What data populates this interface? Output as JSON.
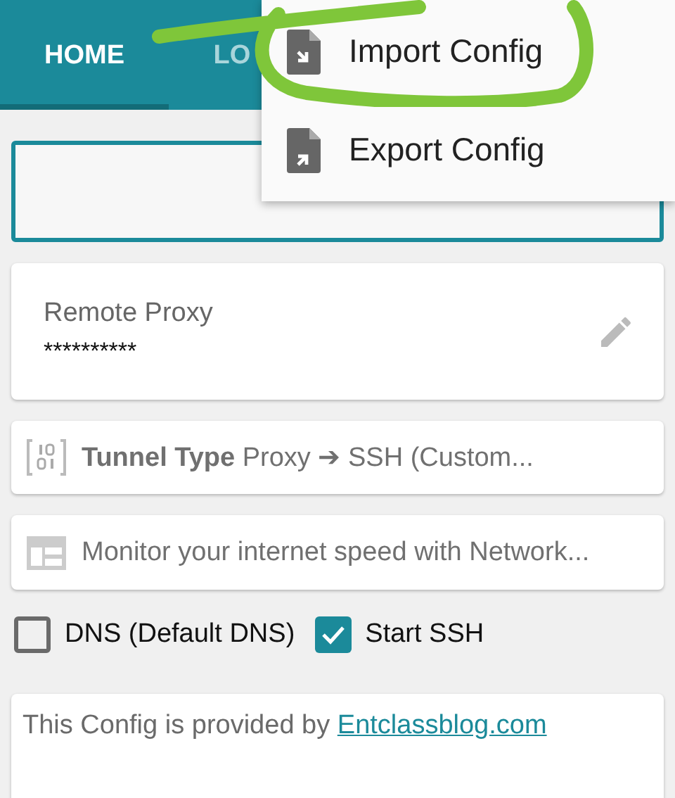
{
  "tabs": [
    {
      "label": "HOME",
      "selected": true
    },
    {
      "label": "LO",
      "selected": false
    }
  ],
  "menu": {
    "items": [
      {
        "label": "Import Config",
        "kind": "import"
      },
      {
        "label": "Export Config",
        "kind": "export"
      }
    ]
  },
  "remote_proxy": {
    "label": "Remote Proxy",
    "value": "**********"
  },
  "tunnel_type": {
    "label": "Tunnel Type",
    "value": "Proxy ➔ SSH (Custom..."
  },
  "banner": {
    "text": "Monitor your internet speed with Network..."
  },
  "options": [
    {
      "label": "DNS (Default DNS)",
      "checked": false
    },
    {
      "label": "Start SSH",
      "checked": true
    }
  ],
  "info": {
    "text": "This Config is provided by",
    "link": "Entclassblog.com"
  }
}
